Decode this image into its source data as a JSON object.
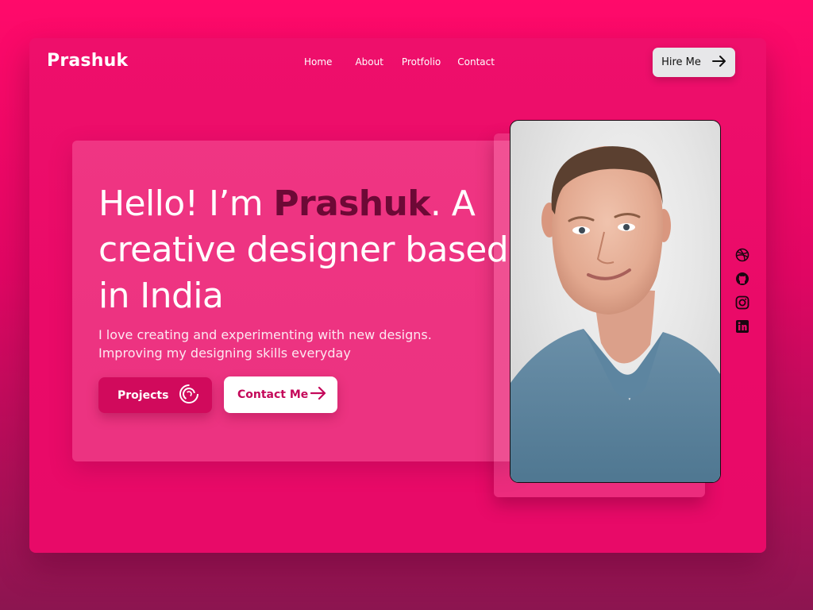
{
  "brand": {
    "logo_text": "Prashuk"
  },
  "nav": {
    "items": [
      {
        "label": "Home"
      },
      {
        "label": "About"
      },
      {
        "label": "Protfolio"
      },
      {
        "label": "Contact"
      }
    ],
    "hire_label": "Hire Me",
    "hire_icon": "arrow-right-icon"
  },
  "hero": {
    "headline_prefix": "Hello! I’m ",
    "headline_name": "Prashuk",
    "headline_suffix": ". A creative designer based in India",
    "subtitle_line1": "I love creating and experimenting with new designs.",
    "subtitle_line2": "Improving my designing skills everyday",
    "projects_label": "Projects",
    "projects_icon": "spinner-icon",
    "contact_label": "Contact Me",
    "contact_icon": "arrow-right-icon"
  },
  "portrait": {
    "icon": "person-portrait-photo"
  },
  "socials": [
    {
      "icon": "dribbble-icon"
    },
    {
      "icon": "github-icon"
    },
    {
      "icon": "instagram-icon"
    },
    {
      "icon": "linkedin-icon"
    }
  ],
  "colors": {
    "background": "#ff0a6a",
    "accent_dark": "#6d0936",
    "button_primary": "#d10a5c",
    "button_light": "#ffffff"
  }
}
